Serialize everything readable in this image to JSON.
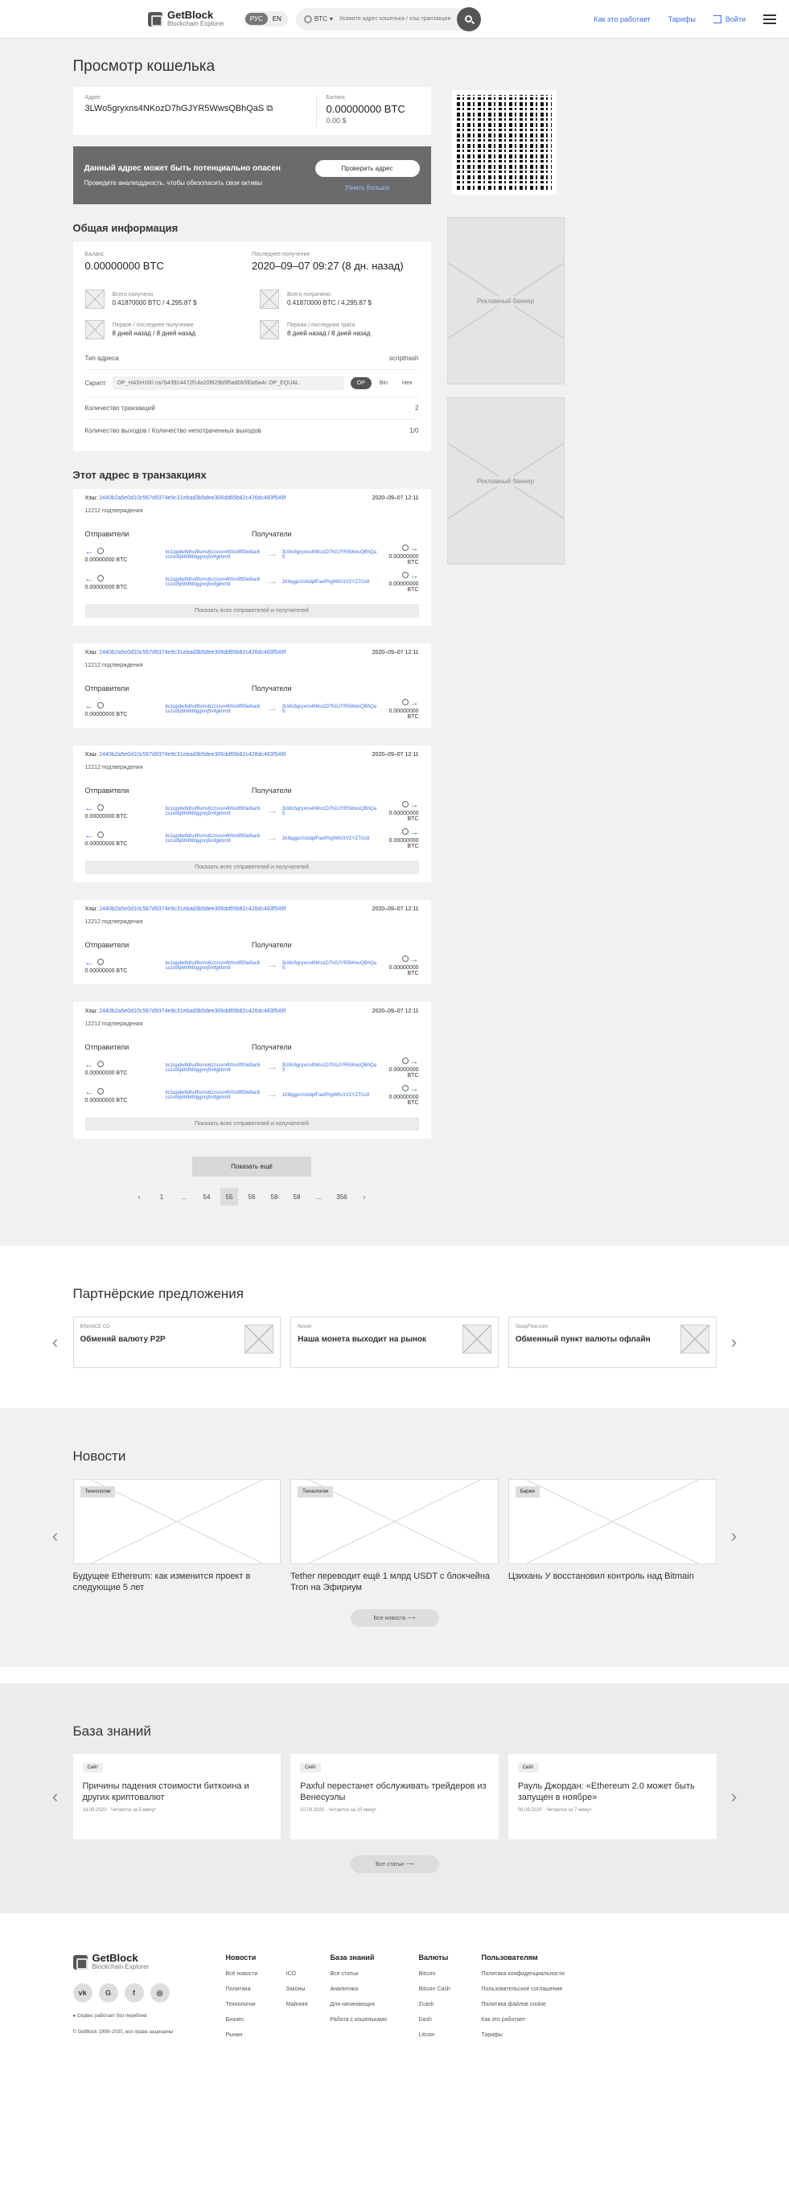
{
  "header": {
    "logo_title": "GetBlock",
    "logo_sub": "Blockchain Explorer",
    "lang": [
      "РУС",
      "EN"
    ],
    "coin": "BTC",
    "search_placeholder": "Укажите адрес кошелька / хэш транзакции",
    "nav_how": "Как это работает",
    "nav_tariffs": "Тарифы",
    "nav_login": "Войти"
  },
  "page_title": "Просмотр кошелька",
  "address": {
    "label": "Адрес",
    "value": "3LWo5gryxns4NKozD7hGJYR5WwsQBhQaS",
    "balance_label": "Баланс",
    "balance_btc": "0.00000000 BTC",
    "balance_usd": "0.00 $"
  },
  "warning": {
    "title": "Данный адрес может быть потенциально опасен",
    "text": "Проведите аналкоддность, чтобы обезопасить свои активы",
    "button": "Проверить адрес",
    "link": "Узнать больше"
  },
  "general": {
    "title": "Общая информация",
    "balance_label": "Баланс",
    "balance": "0.00000000 BTC",
    "last_label": "Последнее получение",
    "last": "2020–09–07 09:27 (8 дн. назад)",
    "received_label": "Всего получено",
    "received": "0.41870000 BTC / 4,295.87 $",
    "sent_label": "Всего потрачено",
    "sent": "0.41870000 BTC / 4,295.87 $",
    "first_recv_label": "Первое / последнее получение",
    "first_recv": "8 дней назад / 8 дней назад",
    "first_spent_label": "Первая / последняя трата",
    "first_spent": "8 дней назад / 8 дней назад",
    "type_label": "Тип адреса",
    "type": "scripthash",
    "script_label": "Скрипт",
    "script": "OP_HASH160 ca7b43914472f14a20f829b5f5ad0b5f0a5a4c OP_EQUAL",
    "script_modes": [
      "OP",
      "Bin",
      "Hex"
    ],
    "tx_count_label": "Количество транзакций",
    "tx_count": "2",
    "outputs_label": "Количество выходов / Количество непотраченных выходов",
    "outputs": "1/0"
  },
  "tx_section_title": "Этот адрес в транзакциях",
  "tx": {
    "hash_label": "Хэш:",
    "hash": "2440b2a5e0d10c567d9374e9c31ebad3b5dee306dd65b82c426dc483f549f",
    "time": "2020–09–07 12:11",
    "confirm": "12212 подтверждения",
    "from": "Отправители",
    "to": "Получатели",
    "from_addr": "bc1qpdw8dhuf8sms6zzssvn4hfsn8f93e8ac6cszvd5j6h96fdggnnj5mfgkhm9",
    "to_addr_1": "3LWo5gryxns4NKozD7hGJYR5WwsQBhQaS",
    "to_addr_2": "1K6qgpsVcbdpfFaoPhgW6VzV2YZ7Gs9",
    "amount": "0.00000000 BTC",
    "show_all": "Показать всех отправителей и получателей"
  },
  "more_button": "Показать ещё",
  "pager": [
    "1",
    "...",
    "54",
    "55",
    "56",
    "58",
    "58",
    "...",
    "356"
  ],
  "banner": "Рекламный баннер",
  "partners": {
    "title": "Партнёрские предложения",
    "items": [
      {
        "src": "BINANCE.CO",
        "title": "Обменяй валюту P2P"
      },
      {
        "src": "Nexeti",
        "title": "Наша монета выходит на рынок"
      },
      {
        "src": "SwapFlow.com",
        "title": "Обменный пункт валюты офлайн"
      }
    ]
  },
  "news": {
    "title": "Новости",
    "items": [
      {
        "tag": "Технологии",
        "title": "Будущее Ethereum: как изменится проект в следующие 5 лет"
      },
      {
        "tag": "Технологии",
        "title": "Tether переводит ещё 1 млрд USDT с блокчейна Tron на Эфириум"
      },
      {
        "tag": "Биржи",
        "title": "Цзихань У восстановил контроль над Bitmain"
      }
    ],
    "all": "Все новости"
  },
  "kb": {
    "title": "База знаний",
    "items": [
      {
        "tag": "Сейт",
        "title": "Причины падения стоимости биткоина и других криптовалют",
        "date": "14.09.2020",
        "read": "Читается за 5 минут"
      },
      {
        "tag": "Сейт",
        "title": "Paxful перестанет обслуживать трейдеров из Венесуэлы",
        "date": "10.09.2020",
        "read": "Читается за 10 минут"
      },
      {
        "tag": "Сейт",
        "title": "Рауль Джордан: «Ethereum 2.0 может быть запущен в ноябре»",
        "date": "08.09.2020",
        "read": "Читается за 7 минут"
      }
    ],
    "all": "Все статьи"
  },
  "footer": {
    "logo_title": "GetBlock",
    "logo_sub": "Blockchain Explorer",
    "social": [
      "vk",
      "g",
      "f",
      "ig"
    ],
    "status": "Сервис работает без перебоев",
    "copyright": "© GetBlock 1998–2020, все права защищены",
    "news_h": "Новости",
    "news_col1": [
      "Всё новости",
      "Политика",
      "Технологии",
      "Бизнес",
      "Рынки"
    ],
    "news_col2": [
      "ICO",
      "Законы",
      "Майнинг"
    ],
    "kb_h": "База знаний",
    "kb_col": [
      "Все статьи",
      "Аналитика",
      "Для начинающих",
      "Работа с кошельками"
    ],
    "cur_h": "Валюты",
    "cur_col": [
      "Bitcoin",
      "Bitcoin Cash",
      "Zcash",
      "Dash",
      "Litcoin"
    ],
    "user_h": "Пользователям",
    "user_col": [
      "Политика конфиденциальности",
      "Пользовательское соглашение",
      "Политика файлов cookie",
      "Как это работает",
      "Тарифы"
    ]
  }
}
